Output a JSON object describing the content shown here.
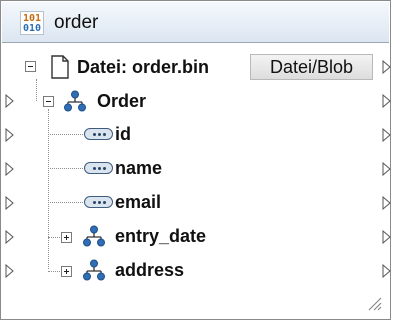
{
  "component": {
    "title": "order",
    "icon_label_top": "101",
    "icon_label_bottom": "010"
  },
  "file_node": {
    "label": "Datei: order.bin",
    "type_button_label": "Datei/Blob",
    "icon": "file-icon"
  },
  "tree": [
    {
      "label": "Order",
      "icon": "element-tree-icon",
      "expanded": true
    },
    {
      "label": "id",
      "icon": "attribute-icon"
    },
    {
      "label": "name",
      "icon": "attribute-icon"
    },
    {
      "label": "email",
      "icon": "attribute-icon"
    },
    {
      "label": "entry_date",
      "icon": "element-tree-icon",
      "expanded": false
    },
    {
      "label": "address",
      "icon": "element-tree-icon",
      "expanded": false
    }
  ]
}
